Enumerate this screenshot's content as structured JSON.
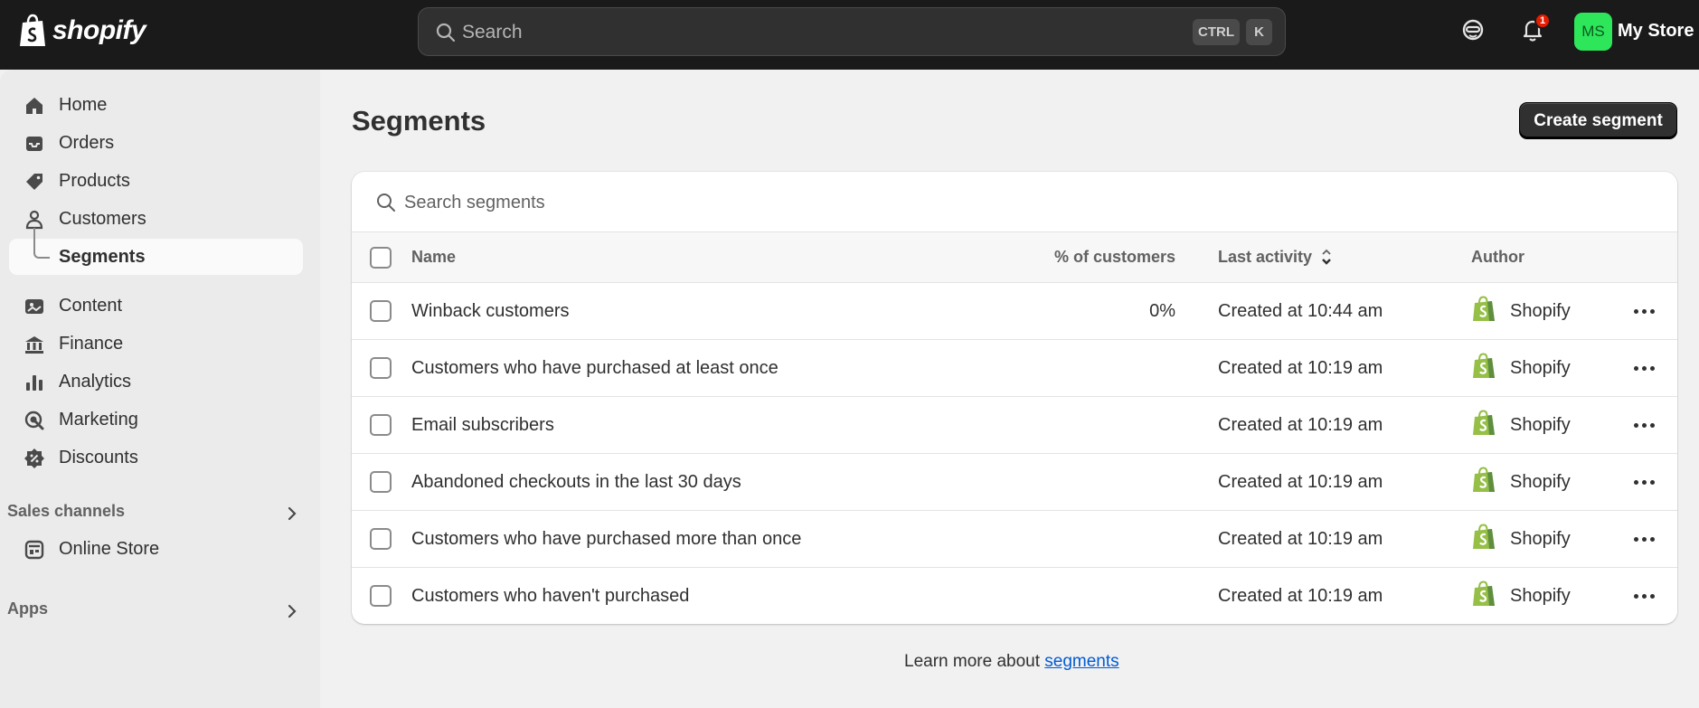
{
  "topbar": {
    "logo_text": "shopify",
    "search_placeholder": "Search",
    "shortcut_ctrl": "CTRL",
    "shortcut_key": "K",
    "notification_count": "1",
    "avatar_initials": "MS",
    "store_name": "My Store",
    "avatar_color": "#2ee65a"
  },
  "sidebar": {
    "items": [
      {
        "label": "Home",
        "icon": "home-icon"
      },
      {
        "label": "Orders",
        "icon": "inbox-icon"
      },
      {
        "label": "Products",
        "icon": "tag-icon"
      },
      {
        "label": "Customers",
        "icon": "person-icon"
      },
      {
        "label": "Segments",
        "icon": "",
        "active": true
      },
      {
        "label": "Content",
        "icon": "image-icon"
      },
      {
        "label": "Finance",
        "icon": "bank-icon"
      },
      {
        "label": "Analytics",
        "icon": "bar-chart-icon"
      },
      {
        "label": "Marketing",
        "icon": "target-icon"
      },
      {
        "label": "Discounts",
        "icon": "discount-icon"
      }
    ],
    "sales_channels_label": "Sales channels",
    "online_store_label": "Online Store",
    "apps_label": "Apps"
  },
  "main": {
    "title": "Segments",
    "create_button": "Create segment",
    "search_placeholder": "Search segments",
    "columns": {
      "name": "Name",
      "pct": "% of customers",
      "activity": "Last activity",
      "author": "Author"
    },
    "rows": [
      {
        "name": "Winback customers",
        "pct": "0%",
        "activity": "Created at 10:44 am",
        "author": "Shopify"
      },
      {
        "name": "Customers who have purchased at least once",
        "pct": "",
        "activity": "Created at 10:19 am",
        "author": "Shopify"
      },
      {
        "name": "Email subscribers",
        "pct": "",
        "activity": "Created at 10:19 am",
        "author": "Shopify"
      },
      {
        "name": "Abandoned checkouts in the last 30 days",
        "pct": "",
        "activity": "Created at 10:19 am",
        "author": "Shopify"
      },
      {
        "name": "Customers who have purchased more than once",
        "pct": "",
        "activity": "Created at 10:19 am",
        "author": "Shopify"
      },
      {
        "name": "Customers who haven't purchased",
        "pct": "",
        "activity": "Created at 10:19 am",
        "author": "Shopify"
      }
    ],
    "footer_text": "Learn more about ",
    "footer_link": "segments"
  }
}
